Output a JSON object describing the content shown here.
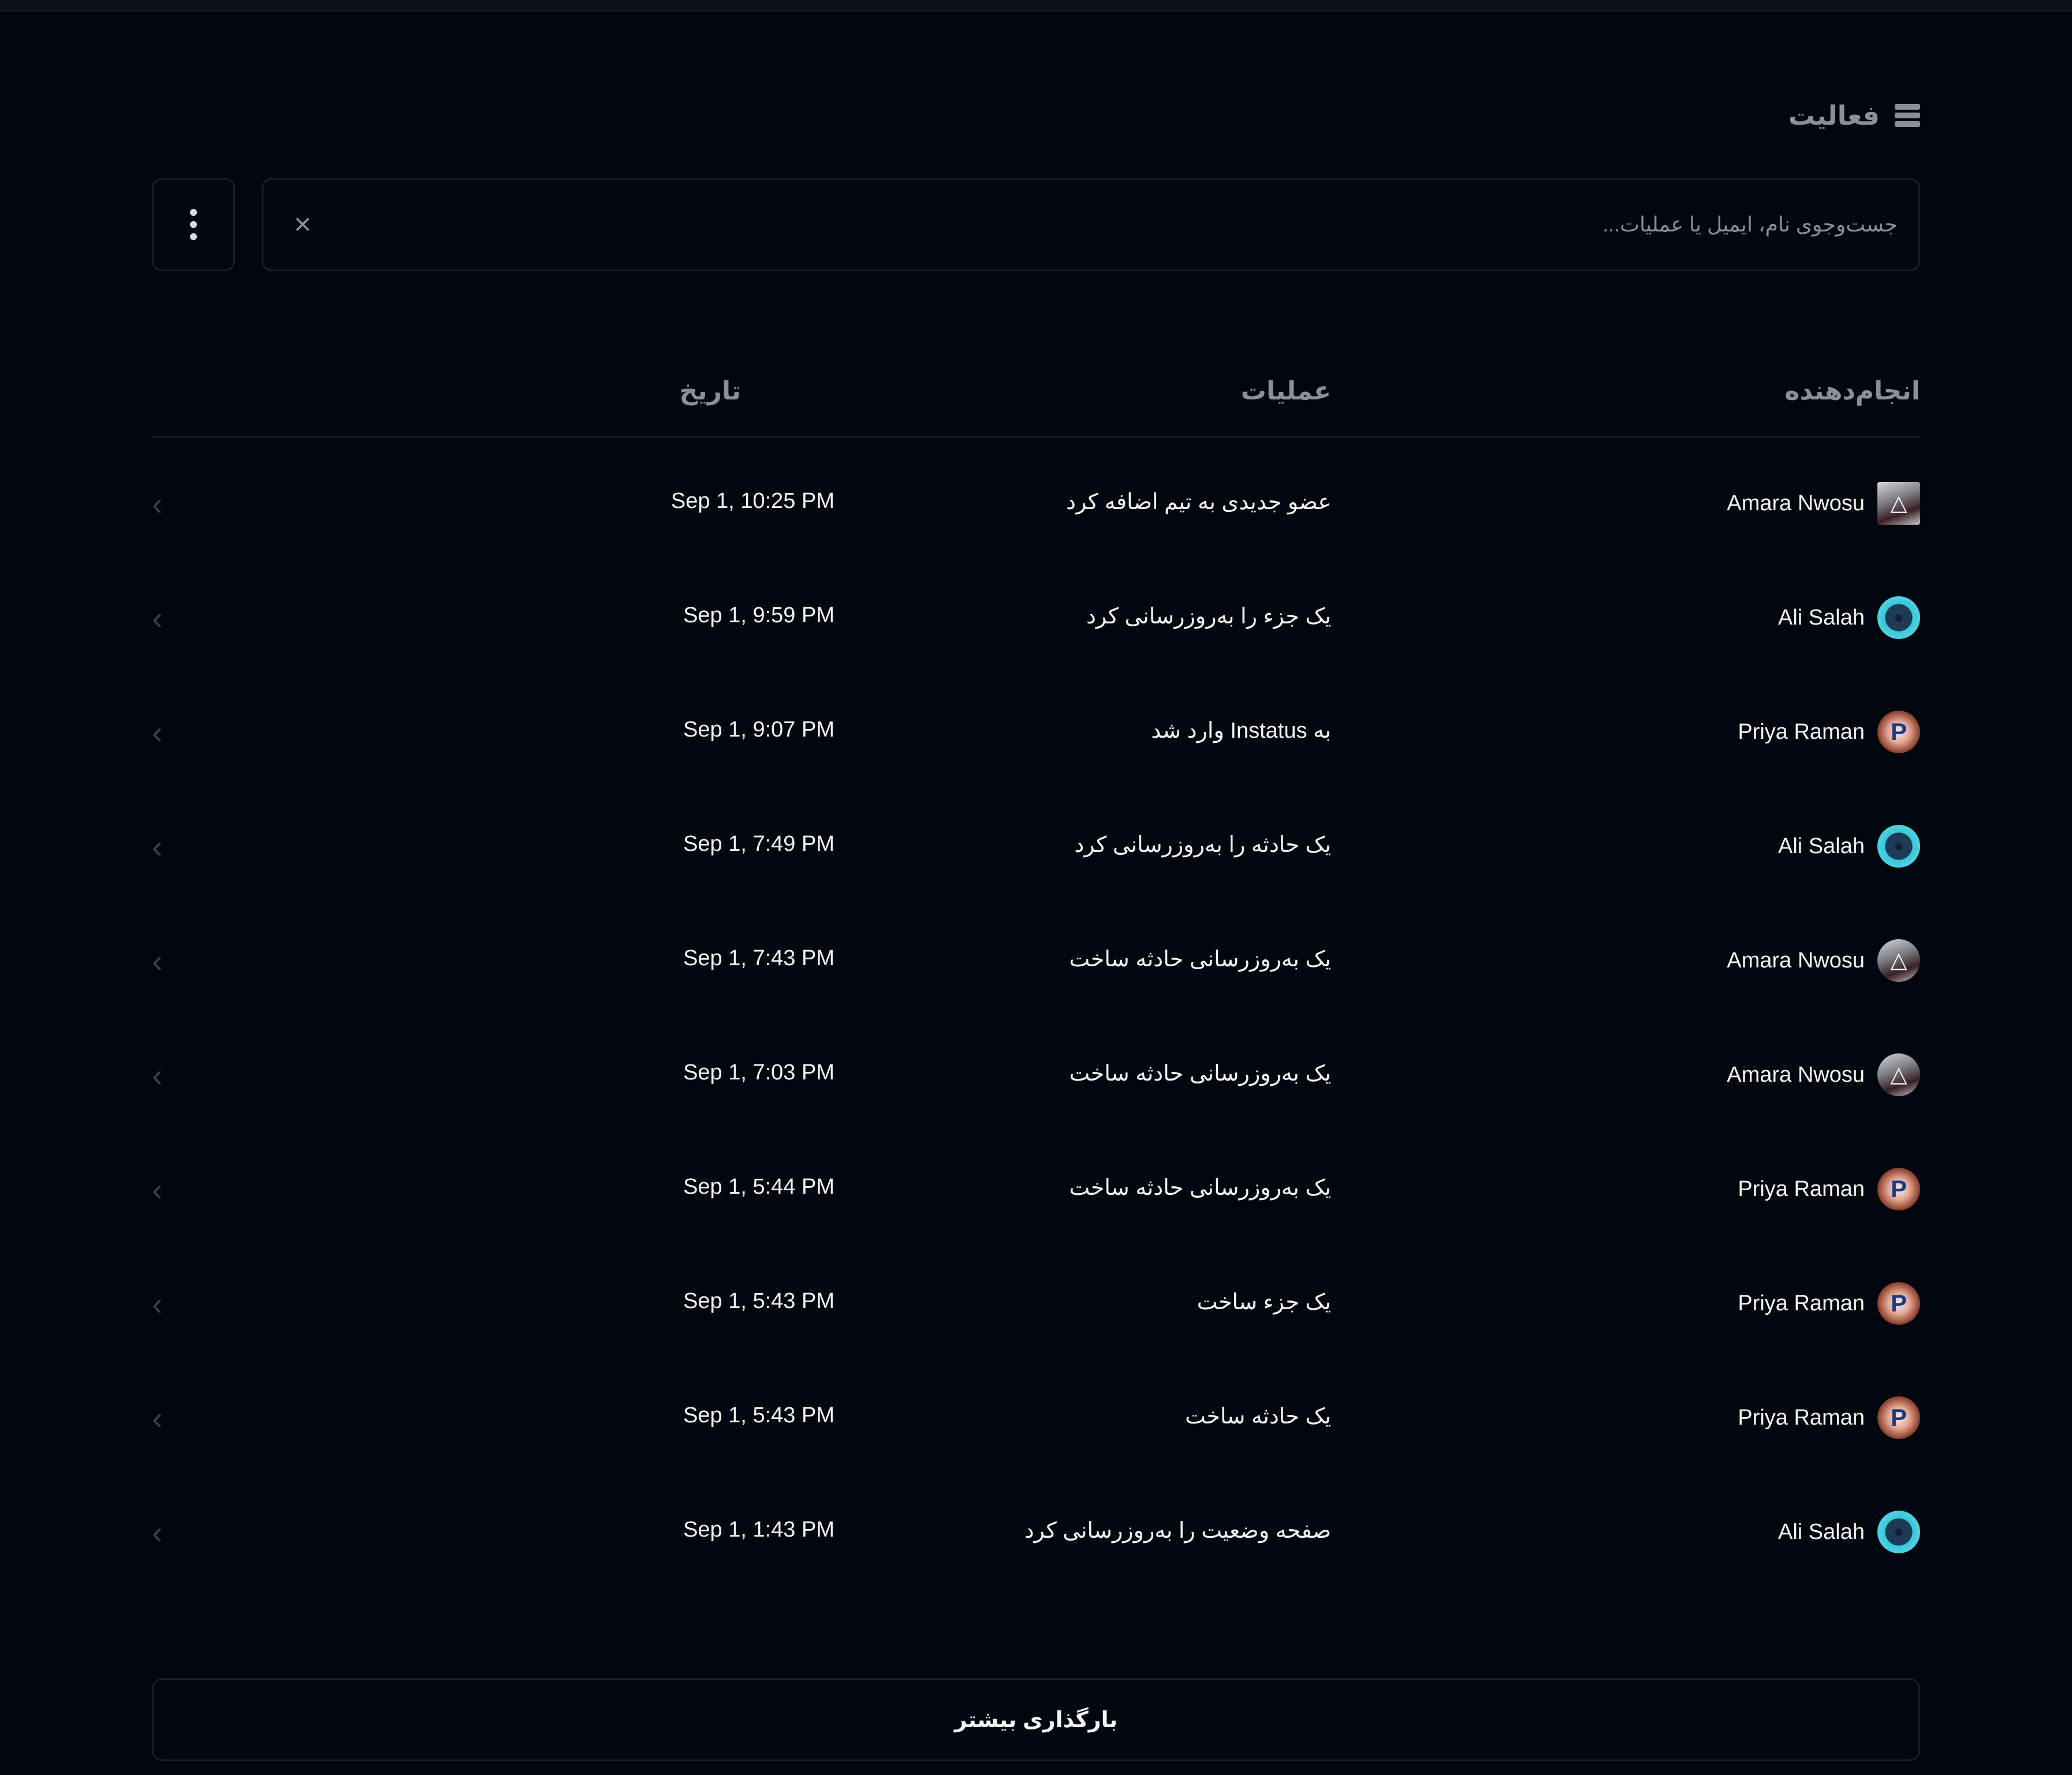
{
  "header": {
    "title": "فعالیت",
    "icon": "server-stack-icon"
  },
  "search": {
    "placeholder": "جست‌وجوی نام، ایمیل یا عملیات..."
  },
  "table": {
    "columns": {
      "actor": "انجام‌دهنده",
      "action": "عملیات",
      "date": "تاریخ"
    },
    "rows": [
      {
        "actor": "Amara Nwosu",
        "avatar": "amara",
        "action": "عضو جدیدی به تیم اضافه کرد",
        "date": "Sep 1, 10:25 PM"
      },
      {
        "actor": "Ali Salah",
        "avatar": "ali",
        "action": "یک جزء را به‌روزرسانی کرد",
        "date": "Sep 1, 9:59 PM"
      },
      {
        "actor": "Priya Raman",
        "avatar": "priya",
        "action": "به Instatus وارد شد",
        "date": "Sep 1, 9:07 PM"
      },
      {
        "actor": "Ali Salah",
        "avatar": "ali",
        "action": "یک حادثه را به‌روزرسانی کرد",
        "date": "Sep 1, 7:49 PM"
      },
      {
        "actor": "Amara Nwosu",
        "avatar": "amara",
        "action": "یک به‌روزرسانی حادثه ساخت",
        "date": "Sep 1, 7:43 PM"
      },
      {
        "actor": "Amara Nwosu",
        "avatar": "amara",
        "action": "یک به‌روزرسانی حادثه ساخت",
        "date": "Sep 1, 7:03 PM"
      },
      {
        "actor": "Priya Raman",
        "avatar": "priya",
        "action": "یک به‌روزرسانی حادثه ساخت",
        "date": "Sep 1, 5:44 PM"
      },
      {
        "actor": "Priya Raman",
        "avatar": "priya",
        "action": "یک جزء ساخت",
        "date": "Sep 1, 5:43 PM"
      },
      {
        "actor": "Priya Raman",
        "avatar": "priya",
        "action": "یک حادثه ساخت",
        "date": "Sep 1, 5:43 PM"
      },
      {
        "actor": "Ali Salah",
        "avatar": "ali",
        "action": "صفحه وضعیت را به‌روزرسانی کرد",
        "date": "Sep 1, 1:43 PM"
      }
    ]
  },
  "load_more": {
    "label": "بارگذاری بیشتر"
  },
  "colors": {
    "background": "#02060f",
    "border": "#1a1f2a",
    "muted_text": "#8b9098",
    "text": "#f3f4f6"
  }
}
